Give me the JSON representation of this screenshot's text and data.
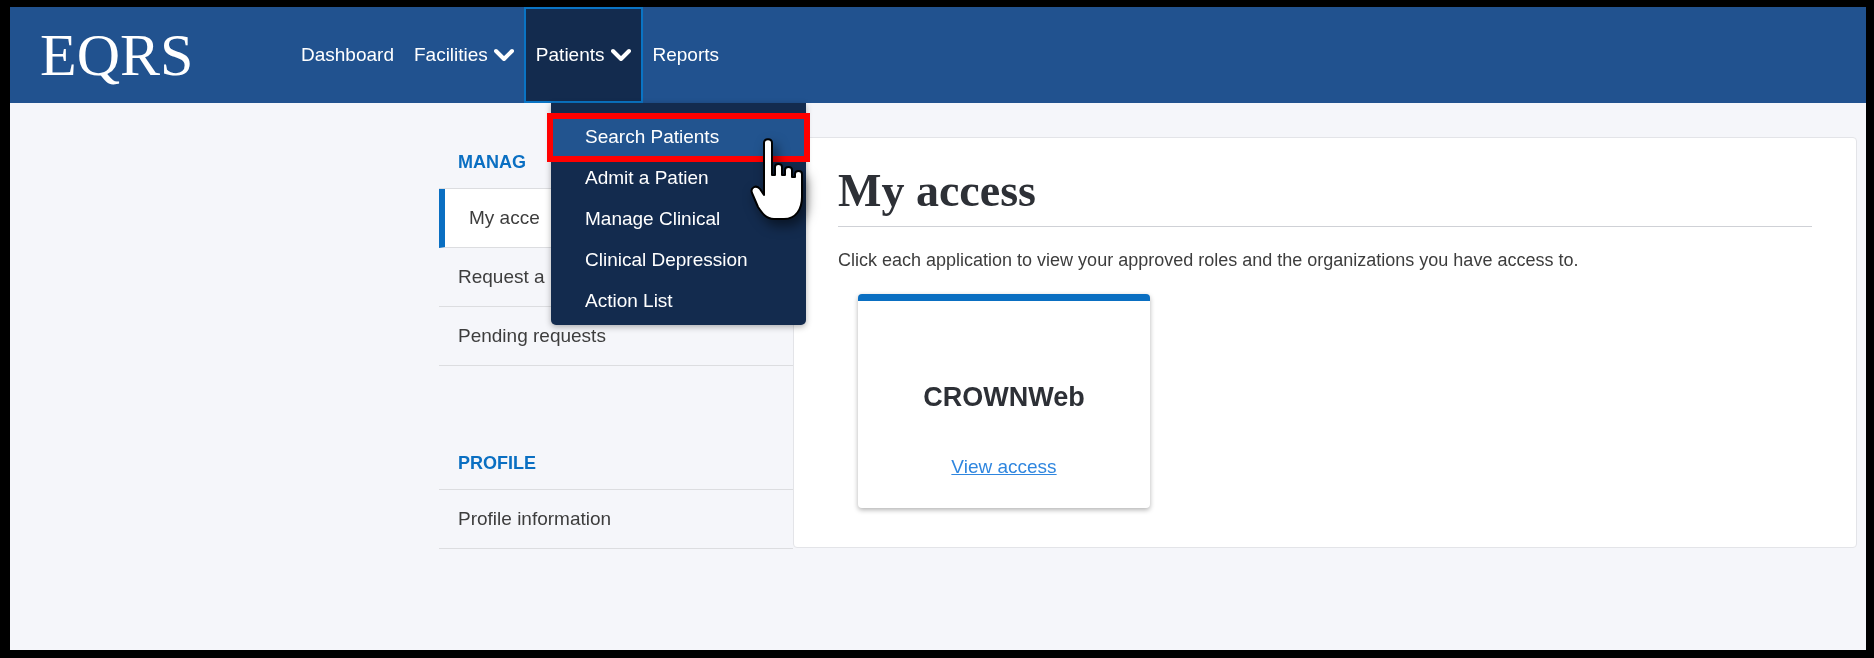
{
  "logo": "EQRS",
  "nav": [
    {
      "label": "Dashboard",
      "dropdown": false,
      "selected": false
    },
    {
      "label": "Facilities",
      "dropdown": true,
      "selected": false
    },
    {
      "label": "Patients",
      "dropdown": true,
      "selected": true
    },
    {
      "label": "Reports",
      "dropdown": false,
      "selected": false
    }
  ],
  "dropdown_menu": [
    {
      "label": "Search Patients",
      "selected": true,
      "annotated": true
    },
    {
      "label": "Admit a Patien",
      "selected": false,
      "annotated": false
    },
    {
      "label": "Manage Clinical",
      "selected": false,
      "annotated": false
    },
    {
      "label": "Clinical Depression",
      "selected": false,
      "annotated": false
    },
    {
      "label": "Action List",
      "selected": false,
      "annotated": false
    }
  ],
  "sidebar": {
    "sections": [
      {
        "heading": "MANAG",
        "items": [
          {
            "label": "My acce",
            "selected": true
          },
          {
            "label": "Request a",
            "selected": false
          },
          {
            "label": "Pending requests",
            "selected": false
          }
        ]
      },
      {
        "heading": "PROFILE",
        "items": [
          {
            "label": "Profile information",
            "selected": false
          }
        ]
      }
    ]
  },
  "main": {
    "title": "My access",
    "description": "Click each application to view your approved roles and the organizations you have access to.",
    "apps": [
      {
        "name": "CROWNWeb",
        "link": "View access"
      }
    ]
  }
}
